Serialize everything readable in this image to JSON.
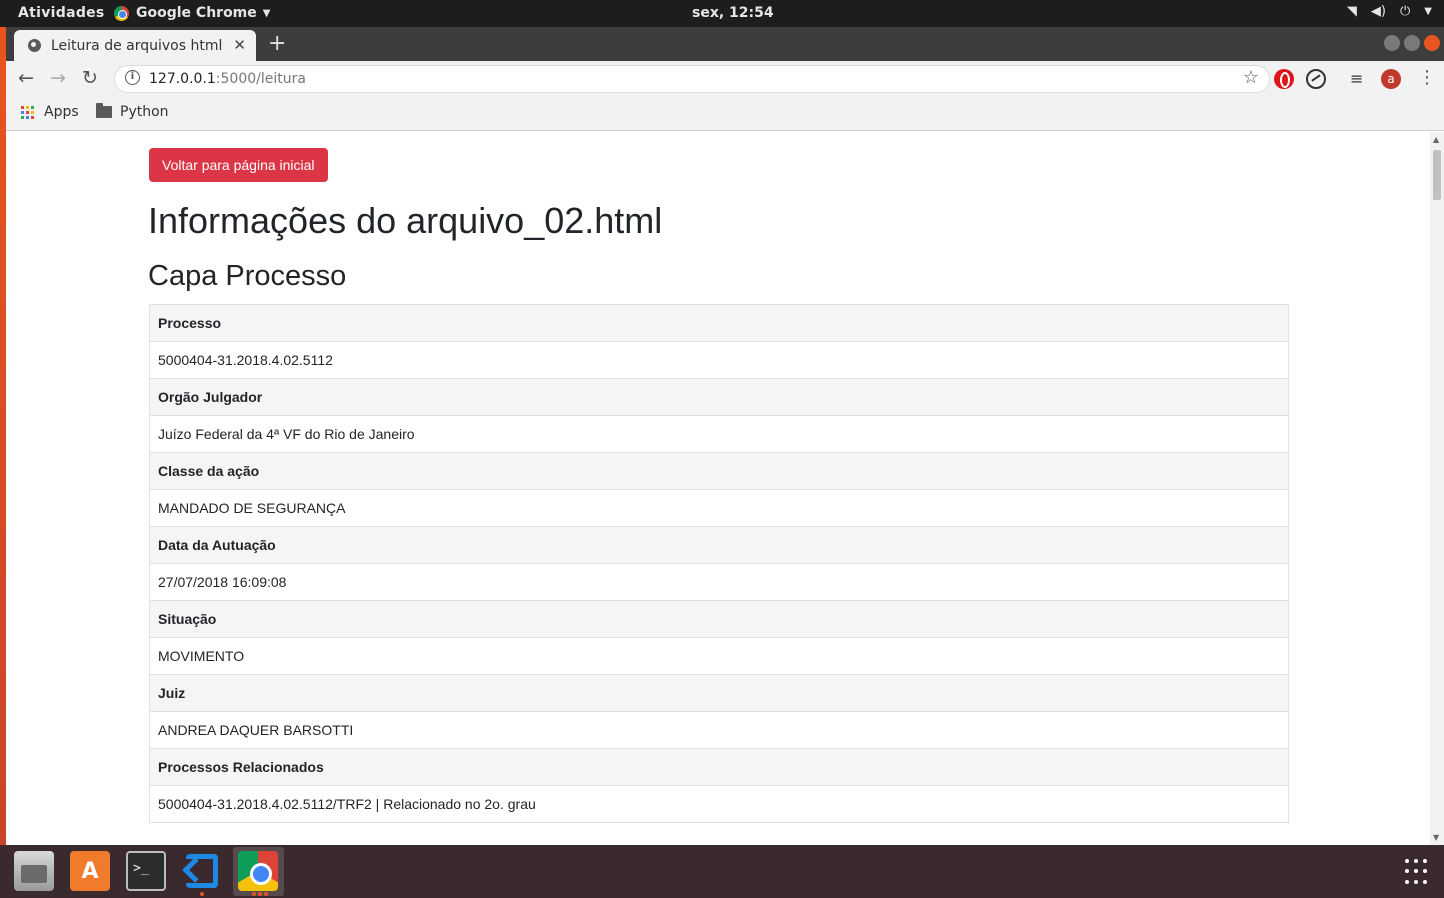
{
  "system": {
    "activities": "Atividades",
    "app_menu": "Google Chrome",
    "clock": "sex, 12:54"
  },
  "browser": {
    "tab_title": "Leitura de arquivos html",
    "url_host": "127.0.0.1",
    "url_rest": ":5000/leitura",
    "bookmarks": [
      {
        "label": "Apps",
        "icon": "apps-grid-icon"
      },
      {
        "label": "Python",
        "icon": "folder-icon"
      }
    ],
    "avatar_letter": "a"
  },
  "page": {
    "back_button": "Voltar para página inicial",
    "title": "Informações do arquivo_02.html",
    "section_title": "Capa Processo",
    "rows": [
      {
        "label": "Processo",
        "value": "5000404-31.2018.4.02.5112"
      },
      {
        "label": "Orgão Julgador",
        "value": "Juízo Federal da 4ª VF do Rio de Janeiro"
      },
      {
        "label": "Classe da ação",
        "value": "MANDADO DE SEGURANÇA"
      },
      {
        "label": "Data da Autuação",
        "value": "27/07/2018 16:09:08"
      },
      {
        "label": "Situação",
        "value": "MOVIMENTO"
      },
      {
        "label": "Juiz",
        "value": "ANDREA DAQUER BARSOTTI"
      },
      {
        "label": "Processos Relacionados",
        "value": "5000404-31.2018.4.02.5112/TRF2 | Relacionado no 2o. grau"
      }
    ]
  },
  "colors": {
    "danger": "#dc3545",
    "ubuntu_orange": "#e95420",
    "table_header_bg": "#f5f5f5",
    "border": "#dee2e6"
  }
}
